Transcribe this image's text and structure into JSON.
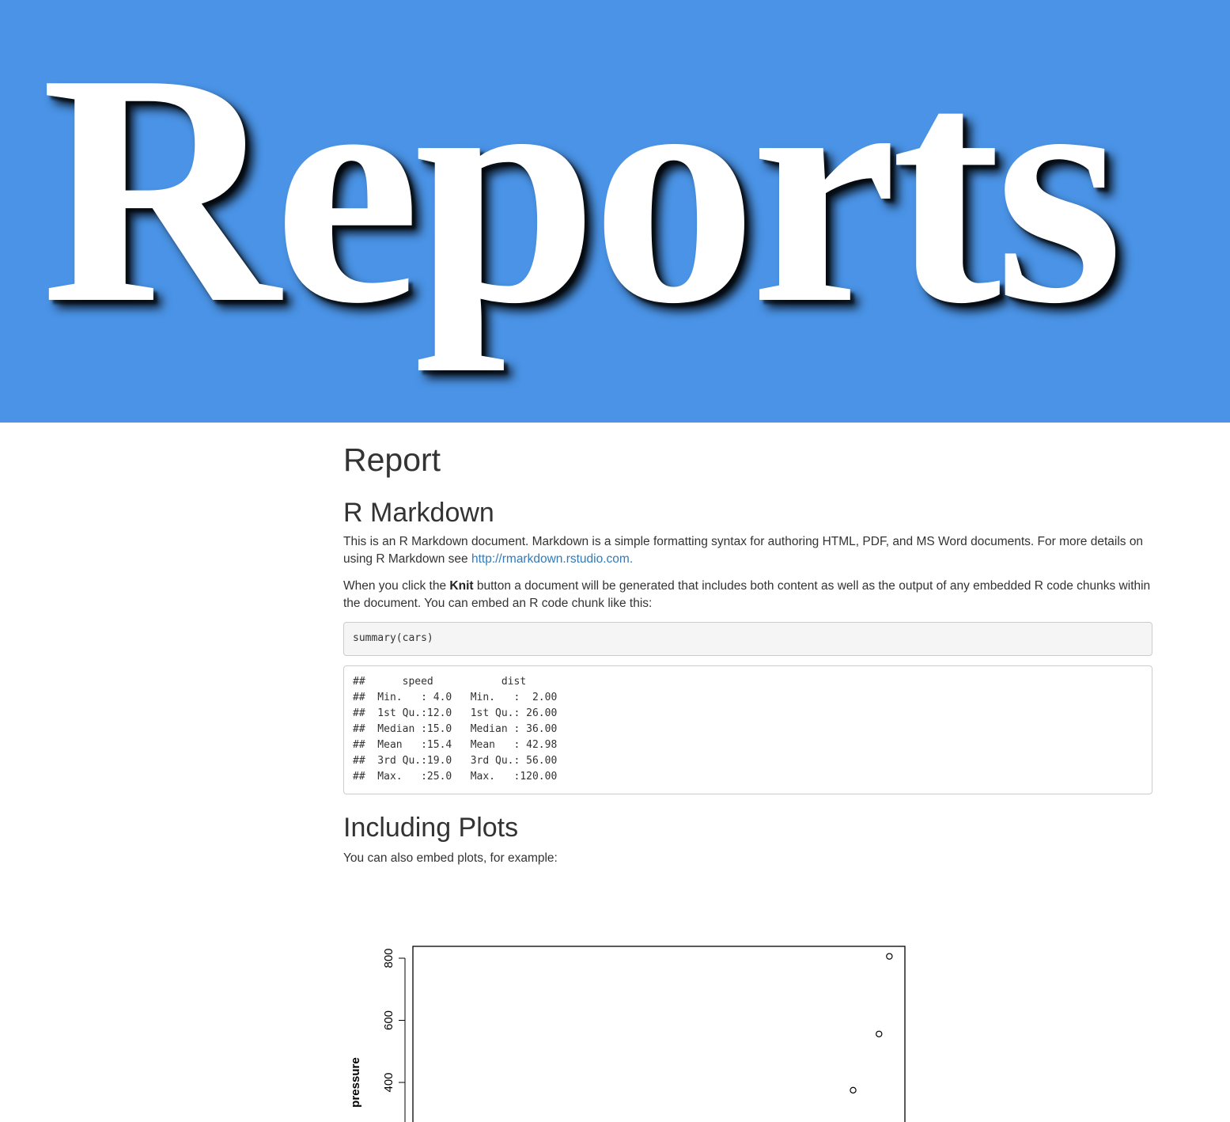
{
  "banner": {
    "title": "Reports",
    "background": "#4a93e6"
  },
  "document": {
    "title": "Report",
    "sections": {
      "rmarkdown": {
        "heading": "R Markdown",
        "para1_text": "This is an R Markdown document. Markdown is a simple formatting syntax for authoring HTML, PDF, and MS Word documents. For more details on using R Markdown see ",
        "para1_link": "http://rmarkdown.rstudio.com.",
        "para2_before": "When you click the ",
        "para2_bold": "Knit",
        "para2_after": " button a document will be generated that includes both content as well as the output of any embedded R code chunks within the document. You can embed an R code chunk like this:",
        "code": "summary(cars)",
        "output_lines": [
          "##      speed           dist       ",
          "##  Min.   : 4.0   Min.   :  2.00  ",
          "##  1st Qu.:12.0   1st Qu.: 26.00  ",
          "##  Median :15.0   Median : 36.00  ",
          "##  Mean   :15.4   Mean   : 42.98  ",
          "##  3rd Qu.:19.0   3rd Qu.: 56.00  ",
          "##  Max.   :25.0   Max.   :120.00  "
        ]
      },
      "plots": {
        "heading": "Including Plots",
        "text": "You can also embed plots, for example:"
      }
    }
  },
  "chart_data": {
    "type": "scatter",
    "title": "",
    "xlabel": "",
    "ylabel": "pressure",
    "y_ticks": [
      400,
      600,
      800
    ],
    "y_tick_labels": [
      "400",
      "600",
      "800"
    ],
    "ylim": [
      0,
      840
    ],
    "xlim": [
      0,
      380
    ],
    "points": [
      {
        "x": 340,
        "y": 375
      },
      {
        "x": 360,
        "y": 556
      },
      {
        "x": 368,
        "y": 806
      }
    ],
    "grid": false,
    "legend": "none"
  }
}
